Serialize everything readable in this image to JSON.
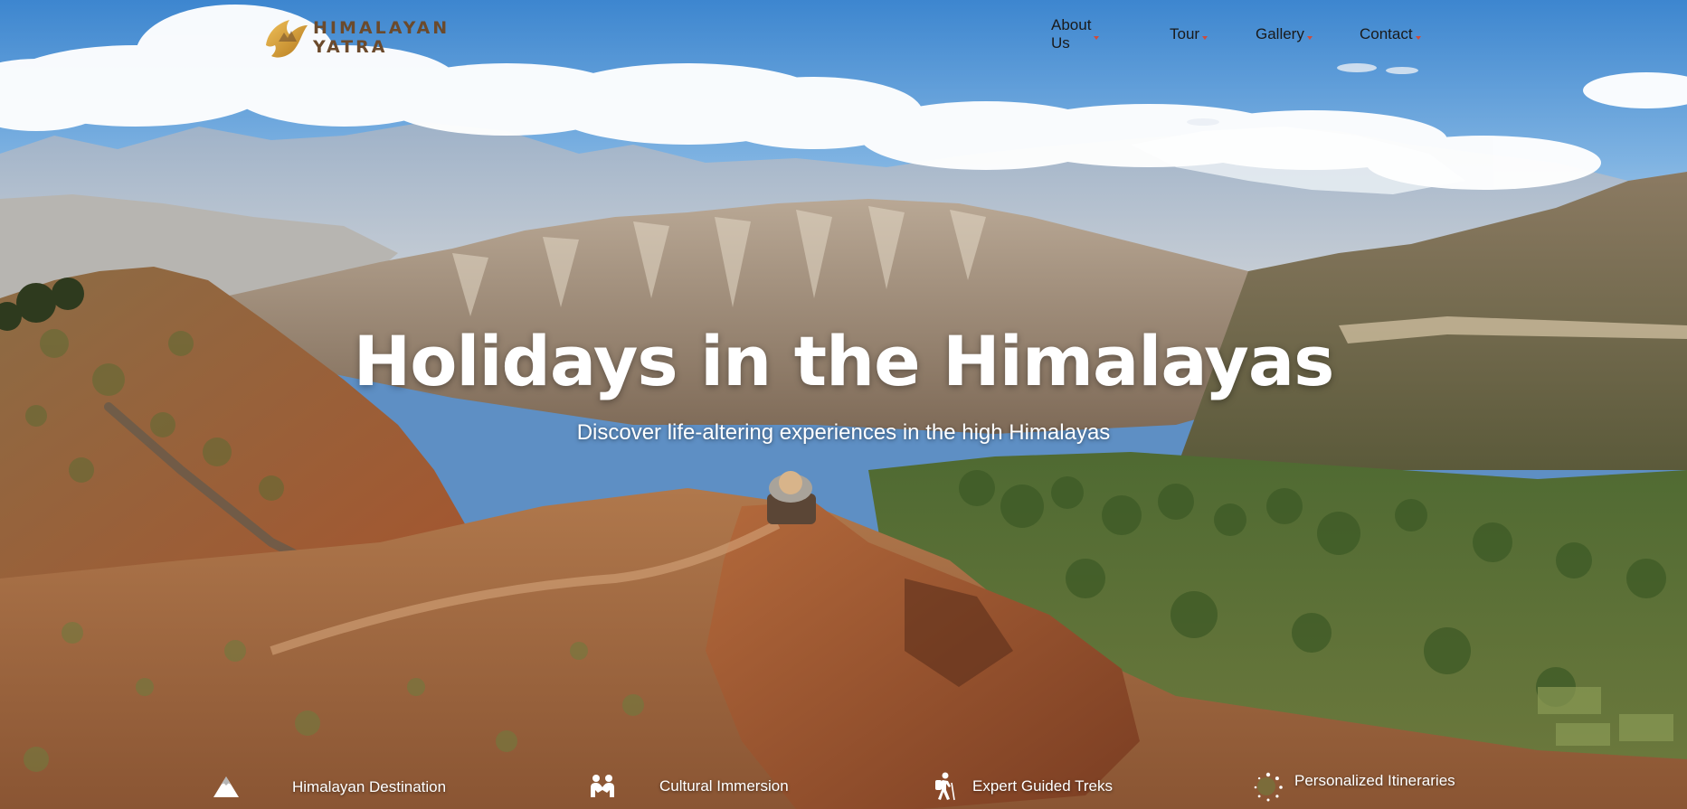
{
  "brand": {
    "name_line1": "HIMALAYAN",
    "name_line2": "YATRA"
  },
  "nav": {
    "items": [
      {
        "label": "About Us"
      },
      {
        "label": "Tour"
      },
      {
        "label": "Gallery"
      },
      {
        "label": "Contact"
      }
    ]
  },
  "hero": {
    "title": "Holidays in the Himalayas",
    "subtitle": "Discover life-altering experiences in the high Himalayas"
  },
  "features": [
    {
      "label": "Himalayan Destination",
      "icon": "mountain-icon"
    },
    {
      "label": "Cultural Immersion",
      "icon": "people-icon"
    },
    {
      "label": "Expert Guided Treks",
      "icon": "hiker-icon"
    },
    {
      "label": "Personalized Itineraries",
      "icon": "dotted-circle-icon"
    }
  ],
  "colors": {
    "brand_brown": "#6b4a2c",
    "brand_gold": "#d9a640",
    "nav_caret": "#d04b3a",
    "sky": "#4f8fd0"
  }
}
